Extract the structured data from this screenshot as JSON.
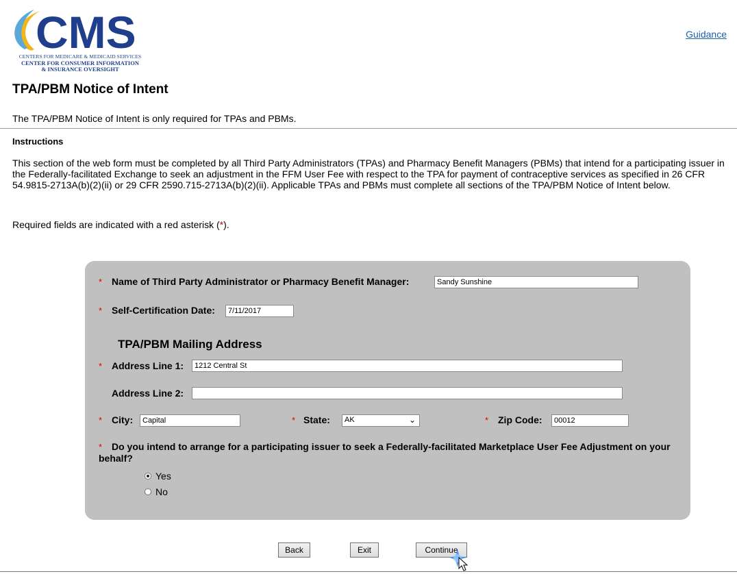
{
  "header": {
    "logo_text": "CMS",
    "logo_line1": "CENTERS FOR MEDICARE & MEDICAID SERVICES",
    "logo_line2": "CENTER FOR CONSUMER INFORMATION",
    "logo_line3": "& INSURANCE OVERSIGHT",
    "guidance_link": "Guidance"
  },
  "page": {
    "title": "TPA/PBM Notice of Intent",
    "intro": "The TPA/PBM Notice of Intent is only required for TPAs and PBMs.",
    "instructions_heading": "Instructions",
    "instructions_body": "This section of the web form must be completed by all Third Party Administrators (TPAs) and Pharmacy Benefit Managers (PBMs) that intend for a participating issuer in the Federally-facilitated Exchange to seek an adjustment in the FFM User Fee with respect to the TPA for payment of contraceptive services as specified in 26 CFR 54.9815-2713A(b)(2)(ii) or 29 CFR 2590.715-2713A(b)(2)(ii). Applicable TPAs and PBMs must complete all sections of the TPA/PBM Notice of Intent below.",
    "required_prefix": "Required fields are indicated with a red asterisk (",
    "required_asterisk": "*",
    "required_suffix": ")."
  },
  "form": {
    "asterisk": "*",
    "name_label": "Name of Third Party Administrator or Pharmacy Benefit Manager:",
    "name_value": "Sandy Sunshine",
    "date_label": "Self-Certification Date:",
    "date_value": "7/11/2017",
    "address_heading": "TPA/PBM Mailing Address",
    "address1_label": "Address Line 1:",
    "address1_value": "1212 Central St",
    "address2_label": "Address Line 2:",
    "address2_value": "",
    "city_label": "City:",
    "city_value": "Capital",
    "state_label": "State:",
    "state_value": "AK",
    "zip_label": "Zip Code:",
    "zip_value": "00012",
    "question": "Do you intend to arrange for a participating issuer to seek a Federally-facilitated Marketplace User Fee Adjustment on your behalf?",
    "option_yes": "Yes",
    "option_no": "No",
    "selected_option": "Yes"
  },
  "buttons": {
    "back": "Back",
    "exit": "Exit",
    "continue": "Continue"
  },
  "colors": {
    "logo_blue": "#1f3f8c",
    "logo_gold": "#f2b51b",
    "logo_lightblue": "#5aa9d6",
    "link": "#1f5fb0",
    "required_red": "#d40000",
    "panel_gray": "#c0c0c0"
  }
}
